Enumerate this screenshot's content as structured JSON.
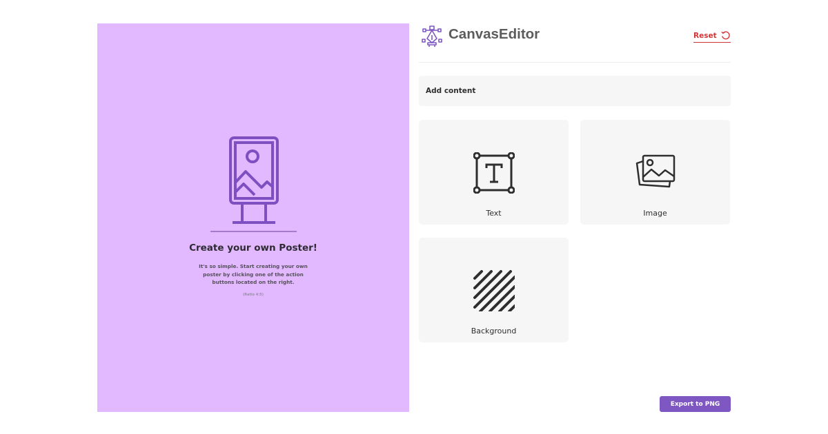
{
  "app": {
    "title": "CanvasEditor"
  },
  "header": {
    "reset_label": "Reset"
  },
  "sidebar": {
    "add_content_label": "Add content",
    "tiles": [
      {
        "label": "Text",
        "icon": "text-icon"
      },
      {
        "label": "Image",
        "icon": "image-icon"
      },
      {
        "label": "Background",
        "icon": "background-icon"
      }
    ]
  },
  "poster": {
    "title": "Create your own Poster!",
    "description": "It's so simple. Start creating your own poster by clicking one of the action buttons located on the right.",
    "ratio_note": "(Ratio 4:5)"
  },
  "footer": {
    "export_label": "Export to PNG"
  },
  "colors": {
    "poster_background": "#e2b9ff",
    "accent": "#7e57c2",
    "reset": "#d23535",
    "tile_background": "#f6f6f6"
  }
}
